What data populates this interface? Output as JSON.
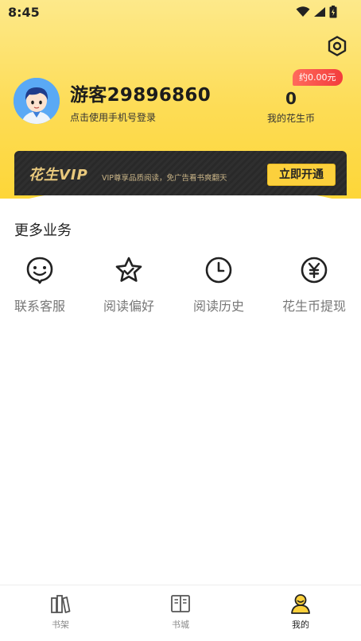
{
  "status_bar": {
    "time": "8:45"
  },
  "profile": {
    "username": "游客29896860",
    "login_hint": "点击使用手机号登录",
    "coin_badge": "约0.00元",
    "coin_count": "0",
    "coin_label": "我的花生币"
  },
  "vip": {
    "logo_text": "花生VIP",
    "description": "VIP尊享品质阅读，免广告看书爽翻天",
    "open_button": "立即开通"
  },
  "services": {
    "title": "更多业务",
    "items": [
      {
        "label": "联系客服",
        "icon": "chat-smile-icon"
      },
      {
        "label": "阅读偏好",
        "icon": "star-icon"
      },
      {
        "label": "阅读历史",
        "icon": "clock-icon"
      },
      {
        "label": "花生币提现",
        "icon": "yen-coin-icon"
      }
    ]
  },
  "bottom_nav": {
    "items": [
      {
        "label": "书架",
        "icon": "bookshelf-icon"
      },
      {
        "label": "书城",
        "icon": "book-open-icon"
      },
      {
        "label": "我的",
        "icon": "profile-icon",
        "active": true
      }
    ]
  },
  "colors": {
    "header_yellow": "#fdd638",
    "accent_yellow": "#fcd03c",
    "badge_red": "#f33c3c",
    "vip_gold": "#e9c97d",
    "vip_dark": "#2f2f2f"
  }
}
